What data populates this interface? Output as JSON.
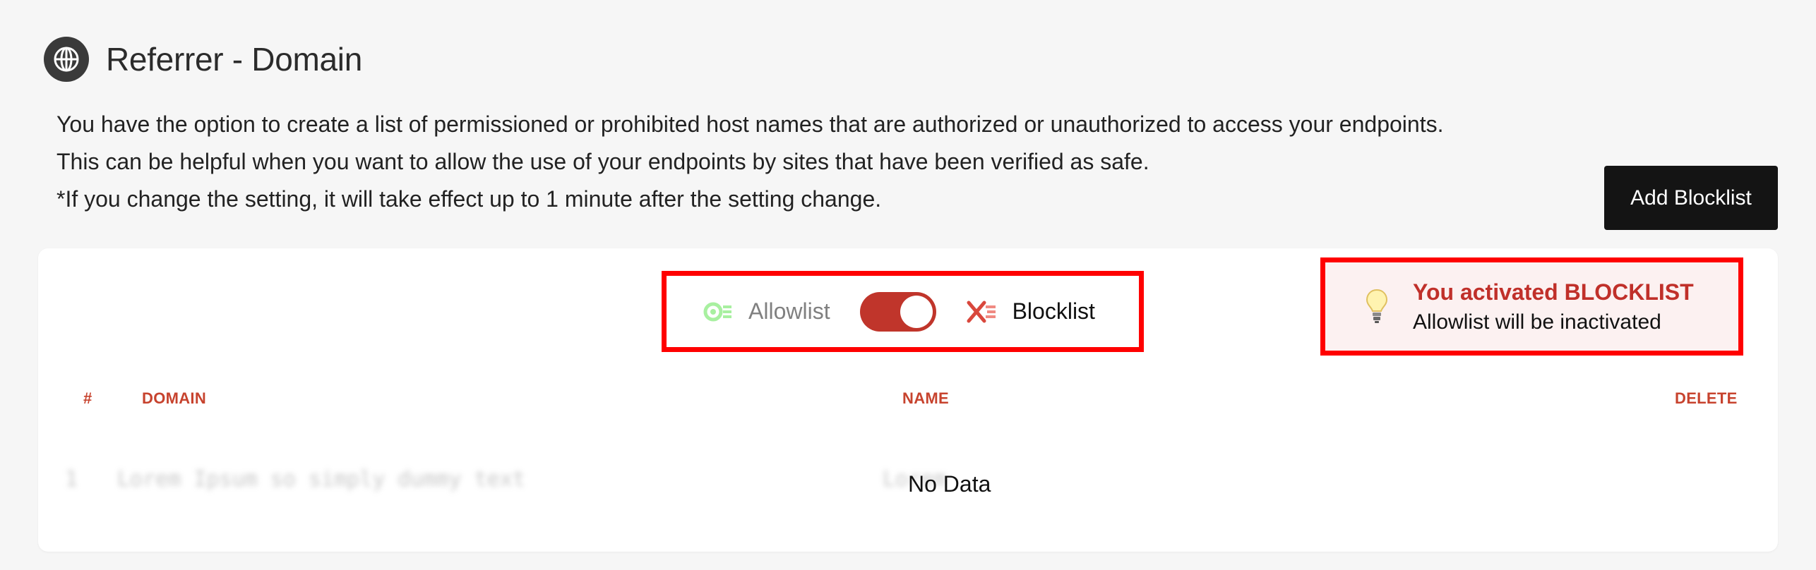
{
  "header": {
    "title": "Referrer - Domain",
    "icon": "globe-icon"
  },
  "description": [
    "You have the option to create a list of permissioned or prohibited host names that are authorized or unauthorized to access your endpoints.",
    "This can be helpful when you want to allow the use of your endpoints by sites that have been verified as safe.",
    "*If you change the setting, it will take effect up to 1 minute after the setting change."
  ],
  "add_button_label": "Add Blocklist",
  "toggle": {
    "left_label": "Allowlist",
    "right_label": "Blocklist",
    "state": "blocklist"
  },
  "notice": {
    "title": "You activated BLOCKLIST",
    "subtitle": "Allowlist will be inactivated"
  },
  "table": {
    "headers": [
      "#",
      "DOMAIN",
      "NAME",
      "DELETE"
    ],
    "blurred_row": {
      "index": "1",
      "domain": "Lorem Ipsum so simply dummy text",
      "name": "Lorem"
    },
    "empty_text": "No Data"
  },
  "colors": {
    "accent_red": "#c0352b",
    "header_red": "#c7432e",
    "highlight_red": "#ff0000",
    "button_black": "#141414",
    "allow_green": "#a8f0a0"
  }
}
